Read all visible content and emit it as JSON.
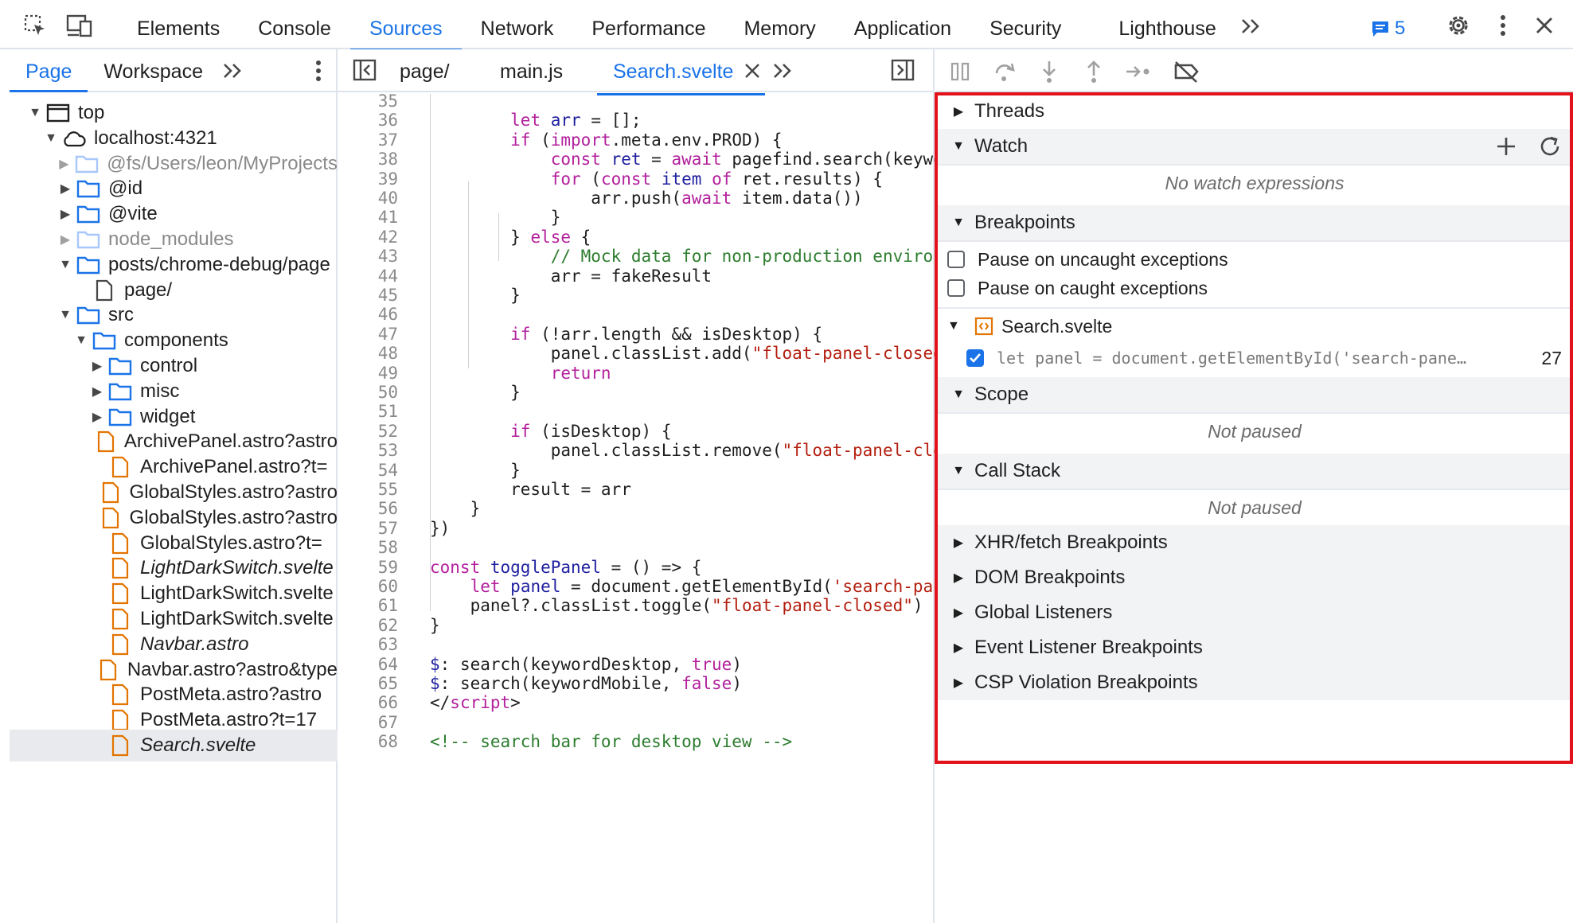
{
  "topbar": {
    "tabs": [
      "Elements",
      "Console",
      "Sources",
      "Network",
      "Performance",
      "Memory",
      "Application",
      "Security",
      "Lighthouse"
    ],
    "active_tab": "Sources",
    "more_label": "»",
    "issues_count": "5"
  },
  "navigator": {
    "tabs": [
      "Page",
      "Workspace"
    ],
    "active_tab": "Page",
    "tree": [
      {
        "label": "top",
        "depth": 0,
        "expanded": true,
        "icon": "frame-icon"
      },
      {
        "label": "localhost:4321",
        "depth": 1,
        "expanded": true,
        "icon": "cloud-icon"
      },
      {
        "label": "@fs/Users/leon/MyProjects",
        "depth": 2,
        "expanded": false,
        "icon": "folder-icon",
        "dim": true
      },
      {
        "label": "@id",
        "depth": 2,
        "expanded": false,
        "icon": "folder-icon"
      },
      {
        "label": "@vite",
        "depth": 2,
        "expanded": false,
        "icon": "folder-icon"
      },
      {
        "label": "node_modules",
        "depth": 2,
        "expanded": false,
        "icon": "folder-icon",
        "dim": true
      },
      {
        "label": "posts/chrome-debug/page",
        "depth": 2,
        "expanded": true,
        "icon": "folder-icon"
      },
      {
        "label": "page/",
        "depth": 3,
        "icon": "file-icon"
      },
      {
        "label": "src",
        "depth": 2,
        "expanded": true,
        "icon": "folder-icon"
      },
      {
        "label": "components",
        "depth": 3,
        "expanded": true,
        "icon": "folder-icon"
      },
      {
        "label": "control",
        "depth": 4,
        "expanded": false,
        "icon": "folder-icon"
      },
      {
        "label": "misc",
        "depth": 4,
        "expanded": false,
        "icon": "folder-icon"
      },
      {
        "label": "widget",
        "depth": 4,
        "expanded": false,
        "icon": "folder-icon"
      },
      {
        "label": "ArchivePanel.astro?astro",
        "depth": 4,
        "icon": "script-file-icon"
      },
      {
        "label": "ArchivePanel.astro?t=",
        "depth": 4,
        "icon": "script-file-icon"
      },
      {
        "label": "GlobalStyles.astro?astro",
        "depth": 4,
        "icon": "script-file-icon"
      },
      {
        "label": "GlobalStyles.astro?astro",
        "depth": 4,
        "icon": "script-file-icon"
      },
      {
        "label": "GlobalStyles.astro?t=",
        "depth": 4,
        "icon": "script-file-icon"
      },
      {
        "label": "LightDarkSwitch.svelte",
        "depth": 4,
        "icon": "script-file-icon",
        "italic": true
      },
      {
        "label": "LightDarkSwitch.svelte",
        "depth": 4,
        "icon": "script-file-icon"
      },
      {
        "label": "LightDarkSwitch.svelte",
        "depth": 4,
        "icon": "script-file-icon"
      },
      {
        "label": "Navbar.astro",
        "depth": 4,
        "icon": "script-file-icon",
        "italic": true
      },
      {
        "label": "Navbar.astro?astro&type",
        "depth": 4,
        "icon": "script-file-icon"
      },
      {
        "label": "PostMeta.astro?astro",
        "depth": 4,
        "icon": "script-file-icon"
      },
      {
        "label": "PostMeta.astro?t=17",
        "depth": 4,
        "icon": "script-file-icon"
      },
      {
        "label": "Search.svelte",
        "depth": 4,
        "icon": "script-file-icon",
        "italic": true,
        "selected": true
      }
    ]
  },
  "editor": {
    "tabs": [
      "page/",
      "main.js",
      "Search.svelte"
    ],
    "active_tab": "Search.svelte",
    "lines": [
      {
        "n": "35",
        "html": ""
      },
      {
        "n": "36",
        "html": "        <span class='kw'>let</span> <span class='vr'>arr</span> = [];"
      },
      {
        "n": "37",
        "html": "        <span class='kw'>if</span> (<span class='kw'>import</span>.meta.env.PROD) {"
      },
      {
        "n": "38",
        "html": "            <span class='kw'>const</span> <span class='vr'>ret</span> = <span class='kw'>await</span> pagefind.search(keyword)"
      },
      {
        "n": "39",
        "html": "            <span class='kw'>for</span> (<span class='kw'>const</span> <span class='vr'>item</span> <span class='kw'>of</span> ret.results) {"
      },
      {
        "n": "40",
        "html": "                arr.push(<span class='kw'>await</span> item.data())"
      },
      {
        "n": "41",
        "html": "            }"
      },
      {
        "n": "42",
        "html": "        } <span class='kw'>else</span> {"
      },
      {
        "n": "43",
        "html": "            <span class='cm'>// Mock data for non-production environment</span>"
      },
      {
        "n": "44",
        "html": "            arr = fakeResult"
      },
      {
        "n": "45",
        "html": "        }"
      },
      {
        "n": "46",
        "html": ""
      },
      {
        "n": "47",
        "html": "        <span class='kw'>if</span> (!arr.length &amp;&amp; isDesktop) {"
      },
      {
        "n": "48",
        "html": "            panel.classList.add(<span class='str'>\"float-panel-closed\"</span>)"
      },
      {
        "n": "49",
        "html": "            <span class='kw'>return</span>"
      },
      {
        "n": "50",
        "html": "        }"
      },
      {
        "n": "51",
        "html": ""
      },
      {
        "n": "52",
        "html": "        <span class='kw'>if</span> (isDesktop) {"
      },
      {
        "n": "53",
        "html": "            panel.classList.remove(<span class='str'>\"float-panel-closed\"</span>)"
      },
      {
        "n": "54",
        "html": "        }"
      },
      {
        "n": "55",
        "html": "        result = arr"
      },
      {
        "n": "56",
        "html": "    }"
      },
      {
        "n": "57",
        "html": "})"
      },
      {
        "n": "58",
        "html": ""
      },
      {
        "n": "59",
        "html": "<span class='kw'>const</span> <span class='vr'>togglePanel</span> = () => {"
      },
      {
        "n": "60",
        "html": "    <span class='kw'>let</span> <span class='vr'>panel</span> = document.getElementById(<span class='str'>'search-panel'</span>)"
      },
      {
        "n": "61",
        "html": "    panel?.classList.toggle(<span class='str'>\"float-panel-closed\"</span>)"
      },
      {
        "n": "62",
        "html": "}"
      },
      {
        "n": "63",
        "html": ""
      },
      {
        "n": "64",
        "html": "<span class='vr'>$</span>: search(keywordDesktop, <span class='kw'>true</span>)"
      },
      {
        "n": "65",
        "html": "<span class='vr'>$</span>: search(keywordMobile, <span class='kw'>false</span>)"
      },
      {
        "n": "66",
        "html": "&lt;/<span class='kw'>script</span>&gt;"
      },
      {
        "n": "67",
        "html": ""
      },
      {
        "n": "68",
        "html": "<span class='cm'>&lt;!-- search bar for desktop view --&gt;</span>"
      }
    ]
  },
  "debugger": {
    "sections": {
      "threads": "Threads",
      "watch": "Watch",
      "watch_empty": "No watch expressions",
      "breakpoints": "Breakpoints",
      "pause_uncaught": "Pause on uncaught exceptions",
      "pause_caught": "Pause on caught exceptions",
      "bp_file": "Search.svelte",
      "bp_code": "let panel = document.getElementById('search-pane…",
      "bp_line": "27",
      "scope": "Scope",
      "scope_empty": "Not paused",
      "callstack": "Call Stack",
      "callstack_empty": "Not paused",
      "xhr": "XHR/fetch Breakpoints",
      "dom": "DOM Breakpoints",
      "global": "Global Listeners",
      "event": "Event Listener Breakpoints",
      "csp": "CSP Violation Breakpoints"
    },
    "highlight_color": "#e3111b"
  }
}
